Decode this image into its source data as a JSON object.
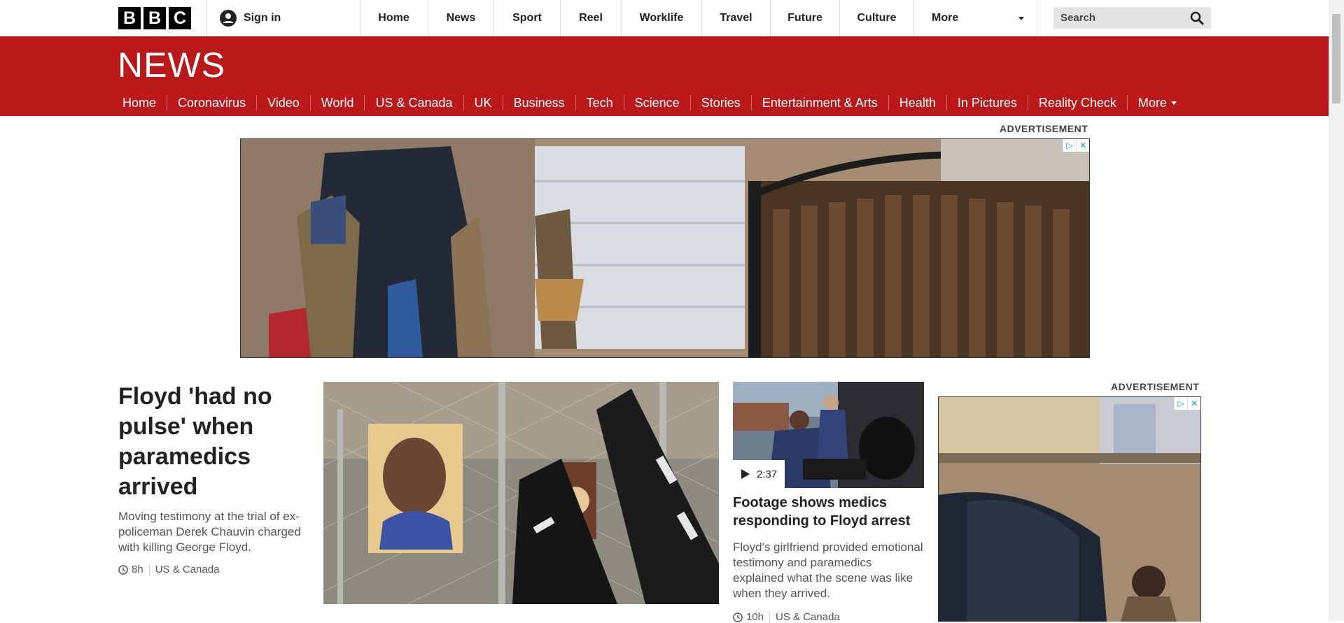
{
  "global": {
    "logo_letters": [
      "B",
      "B",
      "C"
    ],
    "sign_in": "Sign in",
    "nav": [
      "Home",
      "News",
      "Sport",
      "Reel",
      "Worklife",
      "Travel",
      "Future",
      "Culture"
    ],
    "more": "More",
    "search_placeholder": "Search"
  },
  "news": {
    "title": "NEWS",
    "nav": [
      "Home",
      "Coronavirus",
      "Video",
      "World",
      "US & Canada",
      "UK",
      "Business",
      "Tech",
      "Science",
      "Stories",
      "Entertainment & Arts",
      "Health",
      "In Pictures",
      "Reality Check"
    ],
    "active": "Home",
    "more": "More"
  },
  "ads": {
    "top_label": "ADVERTISEMENT",
    "side_label": "ADVERTISEMENT",
    "adchoices_icon": "ad-choices-icon",
    "close_icon": "close-icon"
  },
  "stories": {
    "main": {
      "headline": "Floyd 'had no pulse' when paramedics arrived",
      "summary": "Moving testimony at the trial of ex-policeman Derek Chauvin charged with killing George Floyd.",
      "time": "8h",
      "section": "US & Canada"
    },
    "second": {
      "duration": "2:37",
      "headline": "Footage shows medics responding to Floyd arrest",
      "summary": "Floyd's girlfriend provided emotional testimony and paramedics explained what the scene was like when they arrived.",
      "time": "10h",
      "section": "US & Canada"
    }
  },
  "colors": {
    "brand_red": "#bb1919",
    "text": "#222222",
    "muted": "#555555"
  }
}
